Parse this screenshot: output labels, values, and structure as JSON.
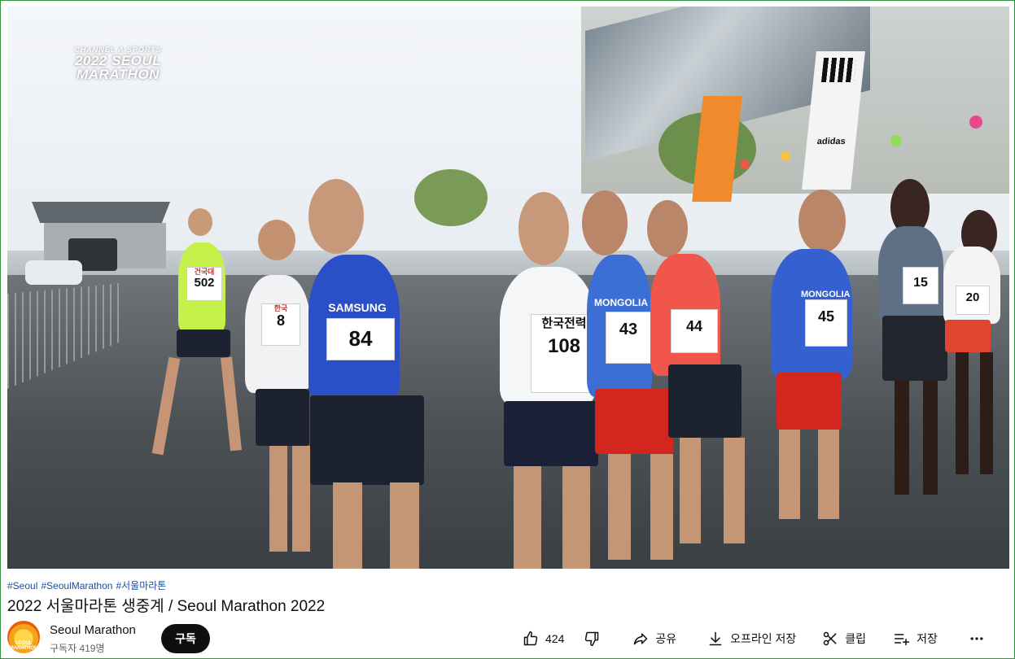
{
  "video": {
    "watermark_small": "CHANNEL A SPORTS",
    "watermark_big_line1": "2022 SEOUL",
    "watermark_big_line2": "MARATHON",
    "banner_brand": "adidas",
    "runners": [
      {
        "team": "건국대",
        "bib": "502",
        "jersey": "#c6f04a"
      },
      {
        "team": "한국",
        "bib": "8",
        "jersey": "#f2f2f4"
      },
      {
        "team": "SAMSUNG",
        "bib": "84",
        "jersey": "#2a4fc7"
      },
      {
        "team": "한국전력",
        "bib": "108",
        "jersey": "#f5f6f8"
      },
      {
        "team": "MONGOLIA",
        "bib": "43",
        "jersey": "#3b6fd6"
      },
      {
        "team": "",
        "bib": "44",
        "jersey": "#f0574a"
      },
      {
        "team": "MONGOLIA",
        "bib": "45",
        "jersey": "#3560d0"
      },
      {
        "team": "",
        "bib": "15",
        "jersey": "#5f6f86"
      },
      {
        "team": "",
        "bib": "20",
        "jersey": "#f4f4f4"
      }
    ]
  },
  "hashtags": [
    "#Seoul",
    "#SeoulMarathon",
    "#서울마라톤"
  ],
  "title": "2022 서울마라톤 생중계 / Seoul Marathon 2022",
  "channel": {
    "name": "Seoul Marathon",
    "subscribers": "구독자 419명",
    "avatar_label": "SEOUL MARATHON"
  },
  "subscribe_label": "구독",
  "actions": {
    "like_count": "424",
    "share_label": "공유",
    "offline_label": "오프라인 저장",
    "clip_label": "클립",
    "save_label": "저장"
  },
  "icons": {
    "like": "thumbs-up-icon",
    "dislike": "thumbs-down-icon",
    "share": "share-icon",
    "download": "download-icon",
    "clip": "scissors-icon",
    "save": "playlist-add-icon",
    "more": "more-horizontal-icon"
  },
  "colors": {
    "subscribe_bg": "#0f0f0f",
    "hashtag": "#1a4f9c",
    "frame_border": "#2f8f3a"
  }
}
